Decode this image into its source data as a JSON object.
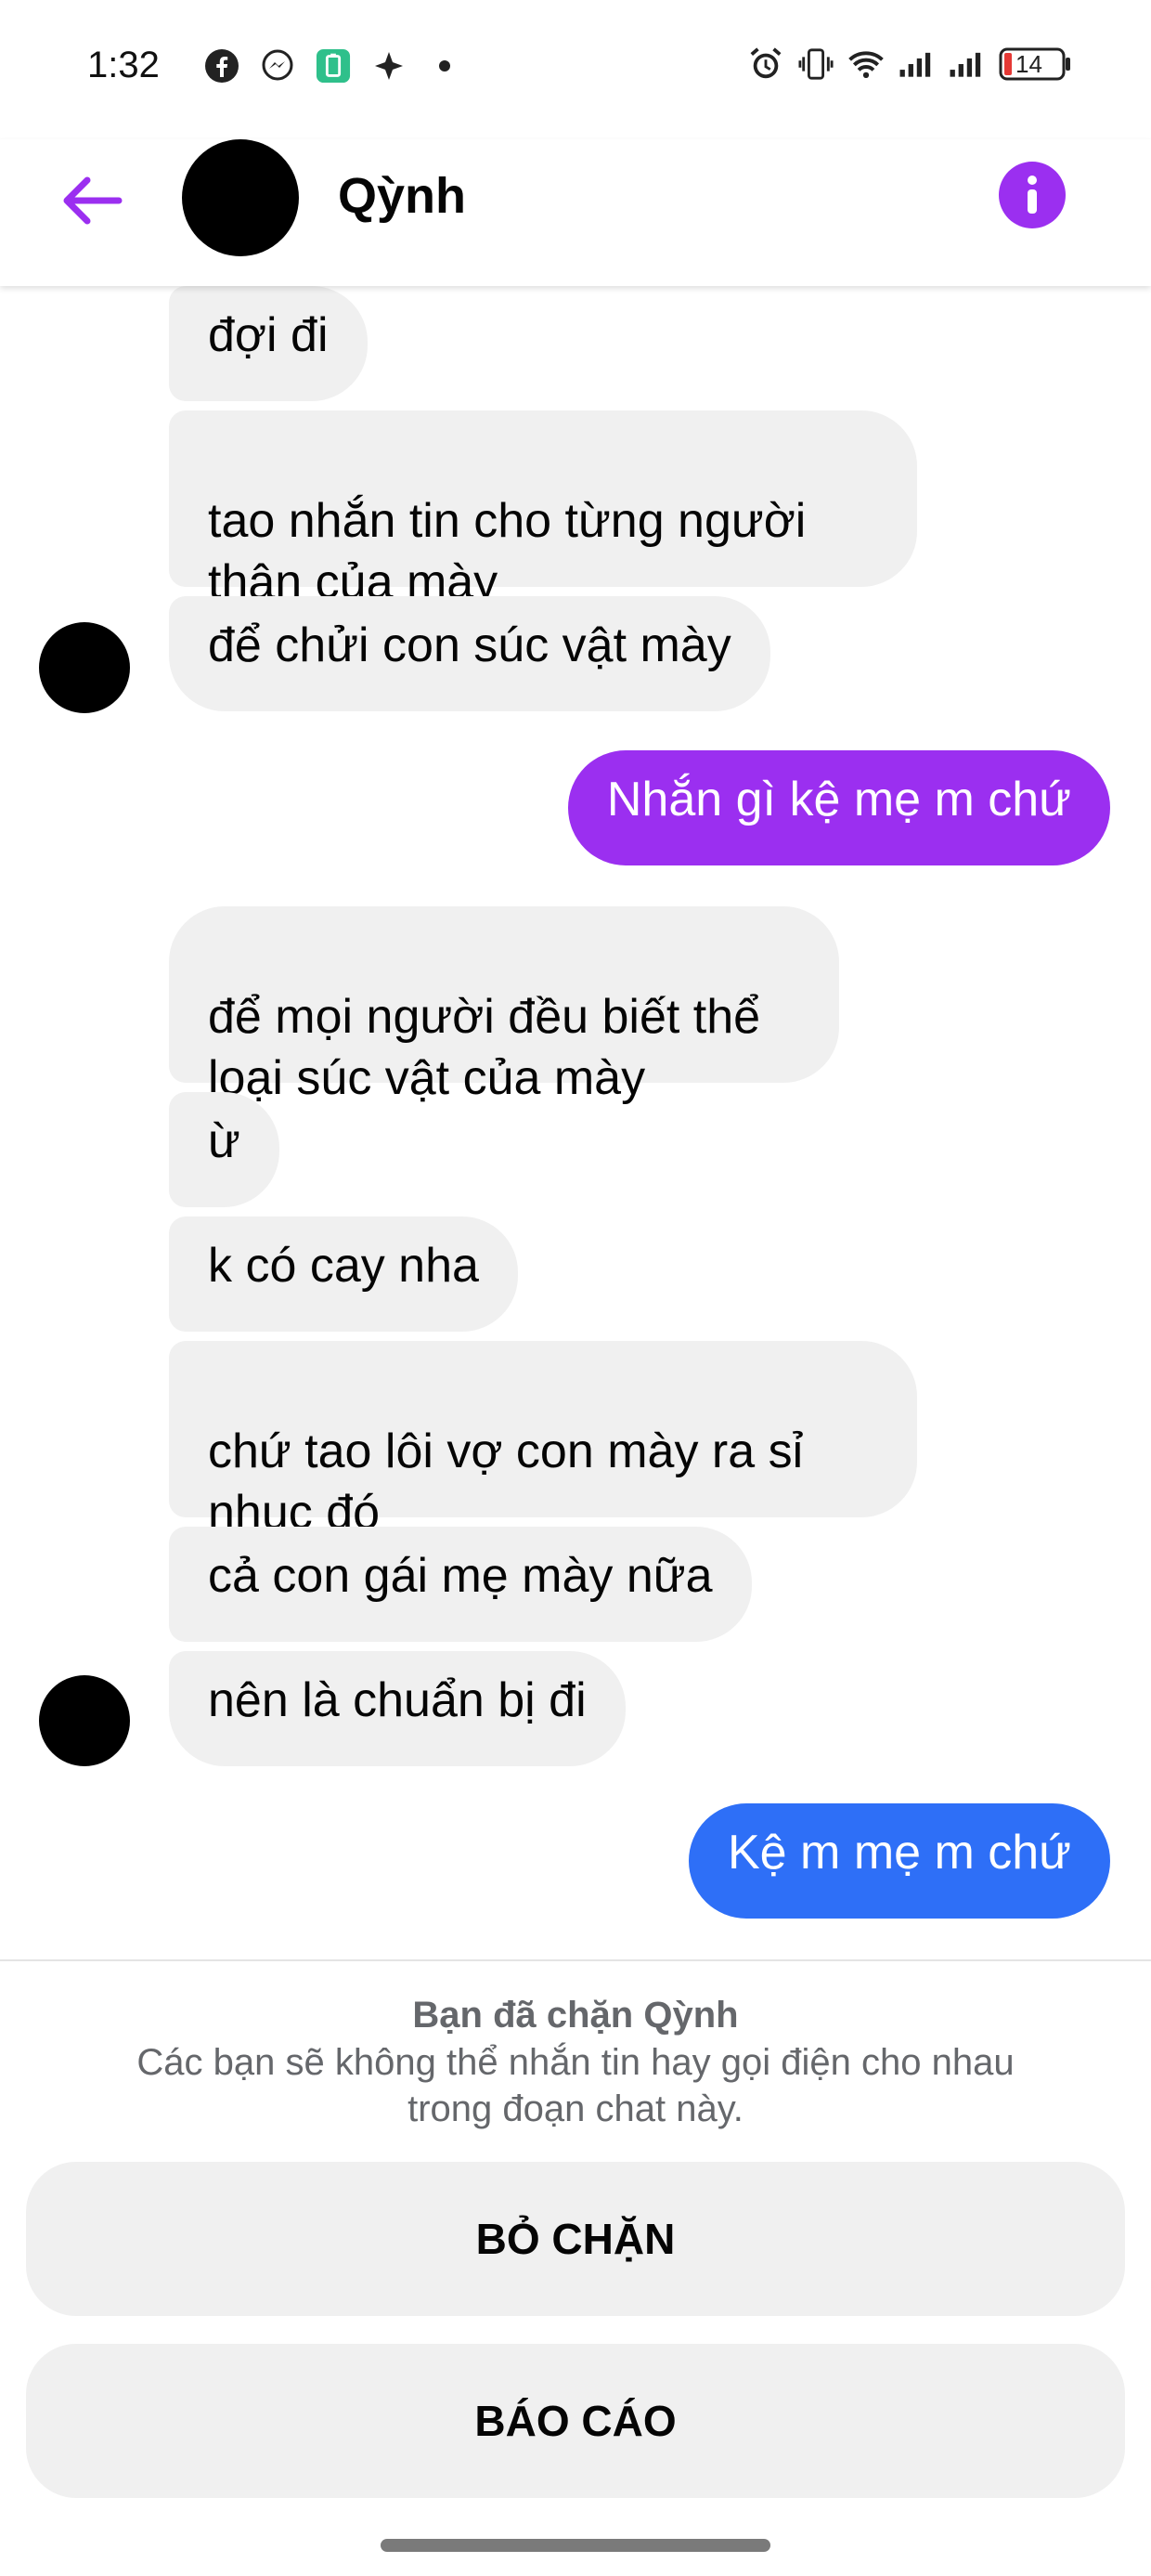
{
  "status_bar": {
    "time": "1:32",
    "left_icons": [
      "facebook-icon",
      "messenger-icon",
      "battery-saver-icon",
      "app-icon",
      "dot-icon"
    ],
    "right_icons": [
      "alarm-icon",
      "vibrate-icon",
      "wifi-icon",
      "signal-icon",
      "signal-icon"
    ],
    "battery_level": "14"
  },
  "header": {
    "contact_name": "Qỳnh",
    "accent_color": "#9b2ff0"
  },
  "messages": [
    {
      "from": "them",
      "text": "đợi đi"
    },
    {
      "from": "them",
      "text": "tao nhắn tin cho từng người\nthân của mày"
    },
    {
      "from": "them",
      "text": "để chửi con súc vật mày"
    },
    {
      "from": "me",
      "text": "Nhắn gì kệ mẹ m chứ",
      "color": "#9b2ff0"
    },
    {
      "from": "them",
      "text": "để mọi người đều biết thể\nloại súc vật của mày"
    },
    {
      "from": "them",
      "text": "ừ"
    },
    {
      "from": "them",
      "text": "k có cay nha"
    },
    {
      "from": "them",
      "text": "chứ tao lôi vợ con mày ra sỉ\nnhục đó"
    },
    {
      "from": "them",
      "text": "cả con gái mẹ mày nữa"
    },
    {
      "from": "them",
      "text": "nên là chuẩn bị đi"
    },
    {
      "from": "me",
      "text": "Kệ m mẹ m chứ",
      "color": "#2e6ff7"
    }
  ],
  "blocked_panel": {
    "title": "Bạn đã chặn Qỳnh",
    "description": "Các bạn sẽ không thể nhắn tin hay gọi điện cho nhau trong đoạn chat này.",
    "unblock_label": "BỎ CHẶN",
    "report_label": "BÁO CÁO"
  }
}
